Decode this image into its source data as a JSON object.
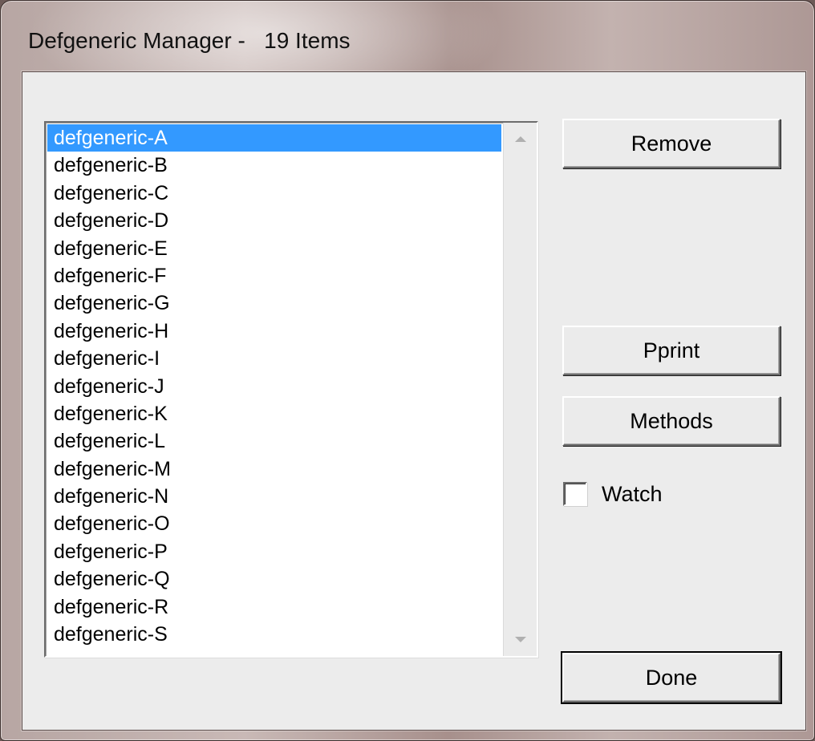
{
  "window": {
    "title": "Defgeneric Manager -   19 Items"
  },
  "list": {
    "items": [
      "defgeneric-A",
      "defgeneric-B",
      "defgeneric-C",
      "defgeneric-D",
      "defgeneric-E",
      "defgeneric-F",
      "defgeneric-G",
      "defgeneric-H",
      "defgeneric-I",
      "defgeneric-J",
      "defgeneric-K",
      "defgeneric-L",
      "defgeneric-M",
      "defgeneric-N",
      "defgeneric-O",
      "defgeneric-P",
      "defgeneric-Q",
      "defgeneric-R",
      "defgeneric-S"
    ],
    "selected_index": 0,
    "scroll_up_icon": "scroll-up-arrow-icon",
    "scroll_down_icon": "scroll-down-arrow-icon"
  },
  "buttons": {
    "remove_label": "Remove",
    "pprint_label": "Pprint",
    "methods_label": "Methods",
    "done_label": "Done"
  },
  "watch": {
    "label": "Watch",
    "checked": false
  },
  "colors": {
    "selection": "#3399ff",
    "dialog_bg": "#ececec"
  }
}
